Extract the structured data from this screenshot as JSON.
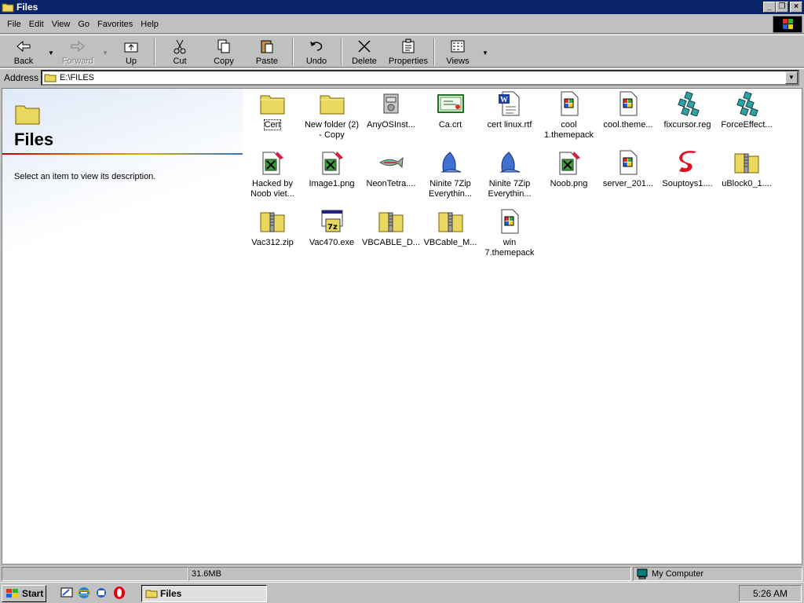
{
  "window": {
    "title": "Files"
  },
  "menu": {
    "file": "File",
    "edit": "Edit",
    "view": "View",
    "go": "Go",
    "favorites": "Favorites",
    "help": "Help"
  },
  "toolbar": {
    "back": "Back",
    "forward": "Forward",
    "up": "Up",
    "cut": "Cut",
    "copy": "Copy",
    "paste": "Paste",
    "undo": "Undo",
    "delete": "Delete",
    "properties": "Properties",
    "views": "Views"
  },
  "address": {
    "label": "Address",
    "value": "E:\\FILES"
  },
  "webview": {
    "title": "Files",
    "description": "Select an item to view its description."
  },
  "files": [
    {
      "name": "Cert",
      "icon": "folder-icon"
    },
    {
      "name": "New folder (2)\n- Copy",
      "icon": "folder-icon"
    },
    {
      "name": "AnyOSInst...",
      "icon": "installer-icon"
    },
    {
      "name": "Ca.crt",
      "icon": "certificate-icon"
    },
    {
      "name": "cert linux.rtf",
      "icon": "word-document-icon"
    },
    {
      "name": "cool\n1.themepack",
      "icon": "themepack-icon"
    },
    {
      "name": "cool.theme...",
      "icon": "themepack-icon"
    },
    {
      "name": "fixcursor.reg",
      "icon": "registry-icon"
    },
    {
      "name": "ForceEffect...",
      "icon": "registry-icon"
    },
    {
      "name": "Hacked by\nNoob viet...",
      "icon": "image-icon"
    },
    {
      "name": "Image1.png",
      "icon": "image-icon"
    },
    {
      "name": "NeonTetra....",
      "icon": "fish-icon"
    },
    {
      "name": "Ninite 7Zip\nEverythin...",
      "icon": "ninite-icon"
    },
    {
      "name": "Ninite 7Zip\nEverythin...",
      "icon": "ninite-icon"
    },
    {
      "name": "Noob.png",
      "icon": "image-icon"
    },
    {
      "name": "server_201...",
      "icon": "themepack-icon"
    },
    {
      "name": "Souptoys1....",
      "icon": "souptoys-icon"
    },
    {
      "name": "uBlock0_1....",
      "icon": "zip-folder-icon"
    },
    {
      "name": "Vac312.zip",
      "icon": "zip-folder-icon"
    },
    {
      "name": "Vac470.exe",
      "icon": "7zip-exe-icon"
    },
    {
      "name": "VBCABLE_D...",
      "icon": "zip-folder-icon"
    },
    {
      "name": "VBCable_M...",
      "icon": "zip-folder-icon"
    },
    {
      "name": "win\n7.themepack",
      "icon": "themepack-icon"
    }
  ],
  "status": {
    "size": "31.6MB",
    "location": "My Computer"
  },
  "taskbar": {
    "start": "Start",
    "task": "Files",
    "clock": "5:26 AM"
  }
}
